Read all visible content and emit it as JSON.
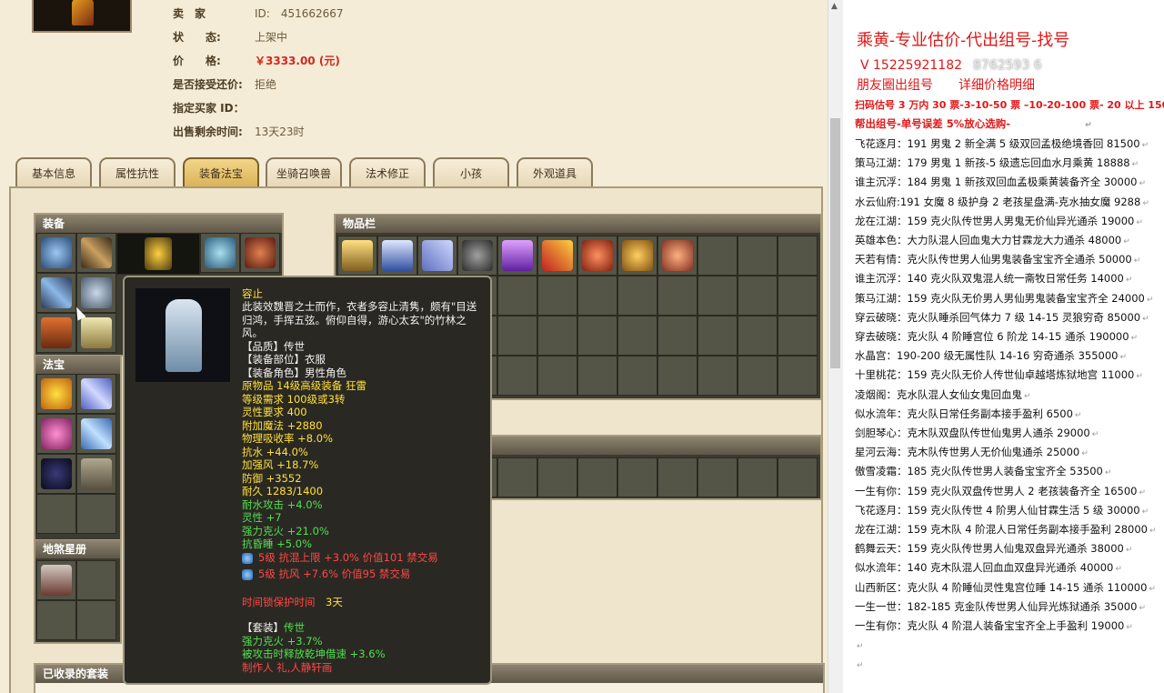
{
  "seller": {
    "rows": [
      {
        "label": "卖　家",
        "value": "ID:　451662667"
      },
      {
        "label": "状　　态:",
        "value": "上架中"
      },
      {
        "label": "价　　格:",
        "value": "￥3333.00 (元)"
      },
      {
        "label": "是否接受还价:",
        "value": "拒绝"
      },
      {
        "label": "指定买家 ID：",
        "value": ""
      },
      {
        "label": "出售剩余时间:",
        "value": "13天23时"
      }
    ]
  },
  "tabs": [
    {
      "label": "基本信息"
    },
    {
      "label": "属性抗性"
    },
    {
      "label": "装备法宝"
    },
    {
      "label": "坐骑召唤兽"
    },
    {
      "label": "法术修正"
    },
    {
      "label": "小孩"
    },
    {
      "label": "外观道具"
    }
  ],
  "panels": {
    "equip": "装备",
    "fabao": "法宝",
    "xingce": "地煞星册",
    "inventory": "物品栏",
    "suits": "已收录的套装"
  },
  "tooltip": {
    "name": "容止",
    "desc": [
      "此装效魏晋之士而作，衣者多容止清隽，颇有\"目送",
      "归鸿，手挥五弦。俯仰自得，游心太玄\"的竹林之",
      "风。"
    ],
    "meta": [
      "【品质】传世",
      "【装备部位】衣服",
      "【装备角色】男性角色"
    ],
    "base": [
      "原物品 14级高级装备 狂雷",
      "等级需求 100级或3转",
      "灵性要求 400",
      "附加魔法 +2880",
      "物理吸收率 +8.0%",
      "抗水 +44.0%",
      "加强风 +18.7%",
      "防御 +3552",
      "耐久 1283/1400"
    ],
    "green": [
      "耐水攻击 +4.0%",
      "灵性 +7",
      "强力克火 +21.0%",
      "抗昏睡 +5.0%"
    ],
    "gems": [
      "5级 抗混上限 +3.0% 价值101 禁交易",
      "5级 抗风 +7.6% 价值95 禁交易"
    ],
    "protect_label": "时间锁保护时间",
    "protect_value": "3天",
    "suit_label": "【套装】",
    "suit_name": "传世",
    "suit_lines": [
      "强力克火 +3.7%",
      "被攻击时释放乾坤借速 +3.6%"
    ],
    "maker": "制作人 礼,人静轩画"
  },
  "right": {
    "title": "乘黄-专业估价-代出组号-找号",
    "phone": "V 15225921182",
    "phone_over": "8762593 6",
    "circle": "朋友圈出组号　　详细价格明细",
    "red1": "扫码估号 3 万内 30 票-3-10-50 票 –10-20-100 票- 20 以上 150",
    "red2": "帮出组号-单号误差 5%放心选购-",
    "listings": [
      "飞花逐月：191 男鬼 2 新全满 5 级双回孟极绝境香回 81500",
      "策马江湖：179 男鬼 1 新孩-5 级遗忘回血水月乘黄 18888",
      "谁主沉浮：184 男鬼 1 新孩双回血孟极乘黄装备齐全 30000",
      "水云仙府:191 女魔 8 级护身 2 老孩星盘满-克水抽女魔 9288",
      "龙在江湖：159 克火队传世男人男鬼无价仙异光通杀 19000",
      "英雄本色：大力队混人回血鬼大力甘霖龙大力通杀 48000",
      "天若有情：克火队传世男人仙男鬼装备宝宝齐全通杀 50000",
      "谁主沉浮：140 克火队双鬼混人统一斋牧日常任务 14000",
      "策马江湖：159 克火队无价男人男仙男鬼装备宝宝齐全 24000",
      "穿云破晓：克火队睡杀回气体力 7 级 14-15 灵狼穷奇 85000",
      "穿去破晓：克火队 4 阶睡宫位 6 阶龙 14-15 通杀 190000",
      "水晶宫：190-200 级无属性队 14-16 穷奇通杀 355000",
      "十里桃花：159 克火队无价人传世仙卓越塔炼狱地宫 11000",
      "凌烟阁：克水队混人女仙女鬼回血鬼",
      "似水流年：克火队日常任务副本接手盈利 6500",
      "剑胆琴心：克木队双盘队传世仙鬼男人通杀 29000",
      "星河云海：克木队传世男人无价仙鬼通杀 25000",
      "傲雪凌霜：185 克火队传世男人装备宝宝齐全 53500",
      "一生有你：159 克火队双盘传世男人 2 老孩装备齐全 16500",
      "飞花逐月：159 克火队传世 4 阶男人仙甘霖生活 5 级 30000",
      "龙在江湖：159 克木队 4 阶混人日常任务副本接手盈利 28000",
      "鹤舞云天：159 克火队传世男人仙鬼双盘异光通杀 38000",
      "似水流年：140 克木队混人回血血双盘异光通杀 40000",
      "山西新区：克火队 4 阶睡仙灵性鬼宫位睡 14-15 通杀 110000",
      "一生一世：182-185 克金队传世男人仙异光炼狱通杀 35000",
      "一生有你：克火队 4 阶混人装备宝宝齐全上手盈利 19000"
    ]
  }
}
